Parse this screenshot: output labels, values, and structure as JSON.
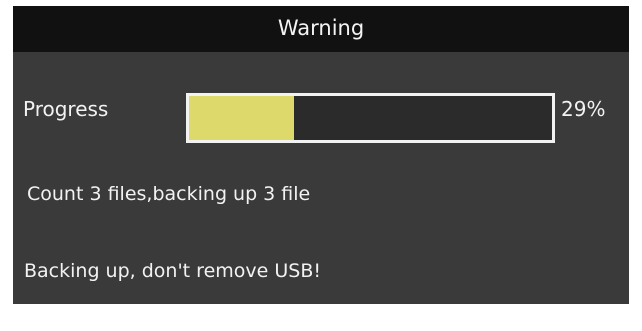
{
  "dialog": {
    "title": "Warning",
    "progress": {
      "label": "Progress",
      "percent_text": "29%",
      "value_fraction": 0.29
    },
    "status_text": "Count 3 files,backing up 3 file",
    "warning_text": "Backing up, don't remove USB!"
  },
  "colors": {
    "title_bar": "#111111",
    "panel": "#3a3a3a",
    "progress_fill": "#ddd96a",
    "text": "#f2f2f2"
  }
}
